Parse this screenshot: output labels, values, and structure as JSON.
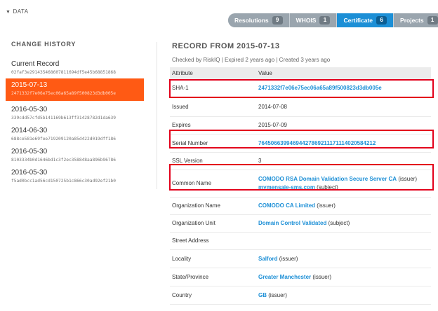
{
  "header": {
    "data_label": "DATA",
    "tabs": [
      {
        "label": "Resolutions",
        "count": "9",
        "active": false
      },
      {
        "label": "WHOIS",
        "count": "1",
        "active": false
      },
      {
        "label": "Certificate",
        "count": "6",
        "active": true
      },
      {
        "label": "Projects",
        "count": "1",
        "active": false
      }
    ]
  },
  "history": {
    "title": "CHANGE HISTORY",
    "items": [
      {
        "date": "Current Record",
        "hash": "02faf3e291435468607811694df5e45b68851868"
      },
      {
        "date": "2015-07-13",
        "hash": "2471332f7e06e75ec06a65a89f500823d3db005e"
      },
      {
        "date": "2016-05-30",
        "hash": "339cdd57cfd5b141169b613ff31428782d1da639"
      },
      {
        "date": "2014-06-30",
        "hash": "688ce581e69fee719209120a85d422d019dff186"
      },
      {
        "date": "2016-05-30",
        "hash": "8103334b0d1646bd1c3f2ec358848aa896b96786"
      },
      {
        "date": "2016-05-30",
        "hash": "f5ad0bcc1ad56cd150725b1c866c30ad92ef21b0"
      }
    ]
  },
  "record": {
    "title": "RECORD FROM 2015-07-13",
    "checked": "Checked by RiskIQ | Expired 2 years ago | Created 3 years ago",
    "col_attribute": "Attribute",
    "col_value": "Value",
    "sha1_label": "SHA-1",
    "sha1_value": "2471332f7e06e75ec06a65a89f500823d3db005e",
    "issued_label": "Issued",
    "issued_value": "2014-07-08",
    "expires_label": "Expires",
    "expires_value": "2015-07-09",
    "serial_label": "Serial Number",
    "serial_value": "76450663994694427869211171114020584212",
    "ssl_label": "SSL Version",
    "ssl_value": "3",
    "cn_label": "Common Name",
    "cn_issuer": "COMODO RSA Domain Validation Secure Server CA",
    "cn_issuer_suffix": "(issuer)",
    "cn_subject": "mymensaje-sms.com",
    "cn_subject_suffix": "(subject)",
    "org_label": "Organization Name",
    "org_value": "COMODO CA Limited",
    "org_suffix": "(issuer)",
    "ou_label": "Organization Unit",
    "ou_value": "Domain Control Validated",
    "ou_suffix": "(subject)",
    "street_label": "Street Address",
    "locality_label": "Locality",
    "locality_value": "Salford",
    "locality_suffix": "(issuer)",
    "state_label": "State/Province",
    "state_value": "Greater Manchester",
    "state_suffix": "(issuer)",
    "country_label": "Country",
    "country_value": "GB",
    "country_suffix": "(issuer)"
  },
  "colors": {
    "accent": "#1c8fd6",
    "selected": "#ff5a14",
    "highlight": "#e3001b"
  }
}
